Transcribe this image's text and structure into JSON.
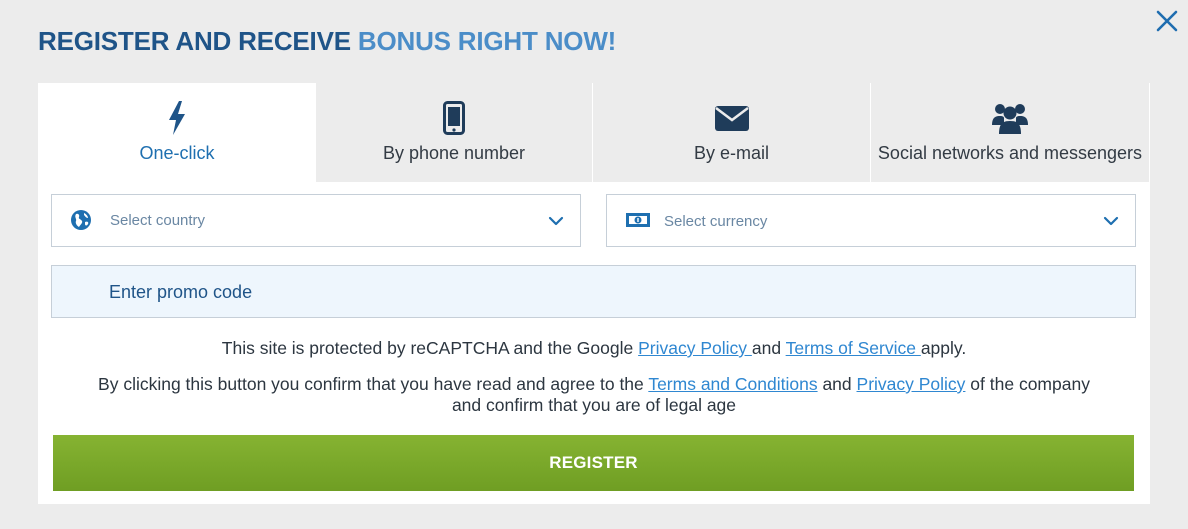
{
  "title": {
    "part1": "REGISTER AND RECEIVE ",
    "part2": "BONUS RIGHT NOW!"
  },
  "close_icon": "close-icon",
  "tabs": [
    {
      "label": "One-click",
      "icon": "lightning-icon",
      "active": true
    },
    {
      "label": "By phone number",
      "icon": "phone-icon",
      "active": false
    },
    {
      "label": "By e-mail",
      "icon": "envelope-icon",
      "active": false
    },
    {
      "label": "Social networks and messengers",
      "icon": "users-icon",
      "active": false
    }
  ],
  "country_select": {
    "placeholder": "Select country",
    "icon": "globe-icon"
  },
  "currency_select": {
    "placeholder": "Select currency",
    "icon": "banknote-icon"
  },
  "promo": {
    "placeholder": "Enter promo code"
  },
  "recaptcha_notice": {
    "text1": "This site is protected by reCAPTCHA and the Google ",
    "privacy_link": "Privacy Policy ",
    "text2": "and ",
    "terms_link": "Terms of Service ",
    "text3": "apply."
  },
  "consent_notice": {
    "text1": "By clicking this button you confirm that you have read and agree to the ",
    "terms_link": "Terms and Conditions",
    "text2": " and ",
    "privacy_link": "Privacy Policy",
    "text3": " of the company and confirm that you are of legal age"
  },
  "register_button": {
    "label": "REGISTER"
  },
  "colors": {
    "accent_dark": "#1f5488",
    "accent_light": "#4b8dc8",
    "register_green": "#7aaa2b",
    "link_blue": "#2f87d1"
  }
}
